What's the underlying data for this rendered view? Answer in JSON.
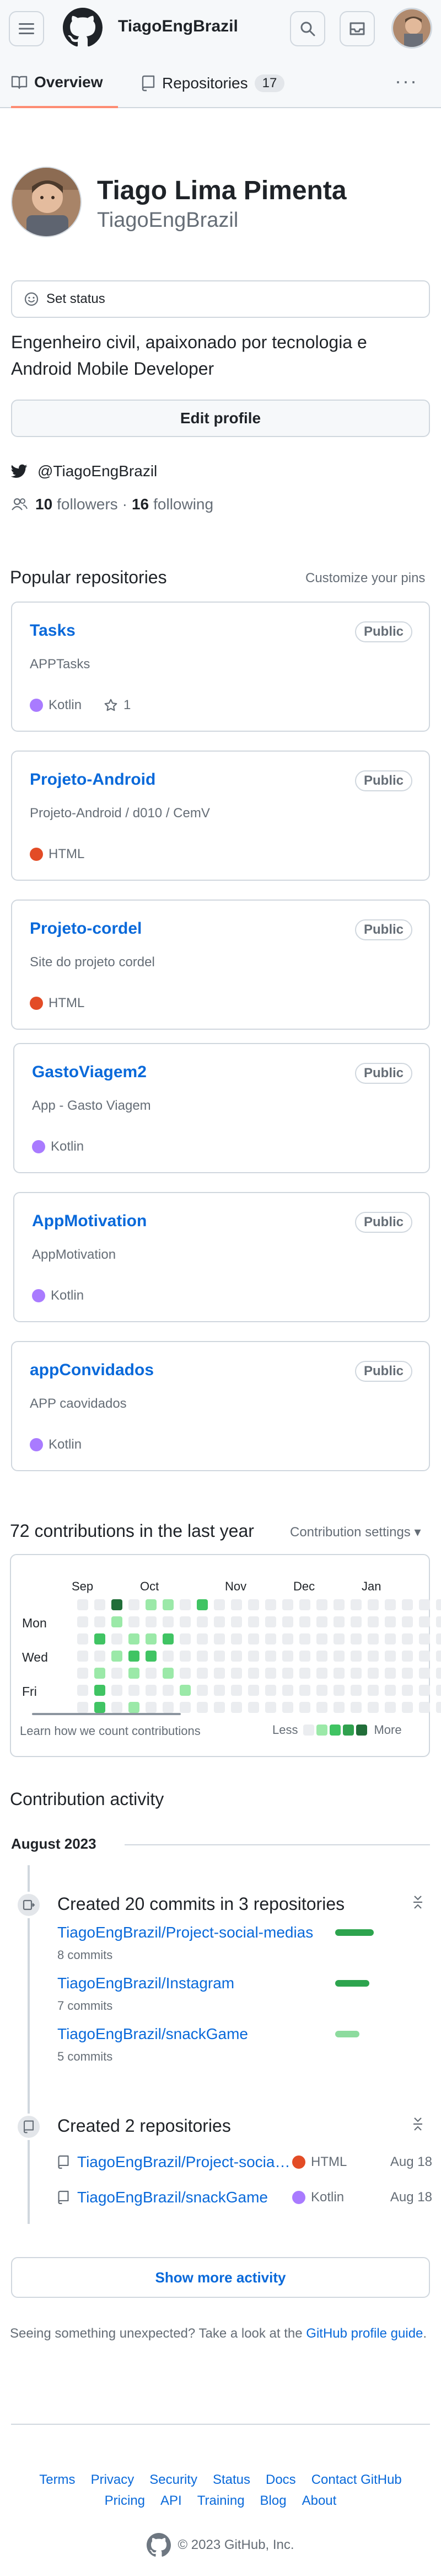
{
  "header": {
    "username": "TiagoEngBrazil"
  },
  "tabs": [
    {
      "label": "Overview"
    },
    {
      "label": "Repositories",
      "count": "17"
    }
  ],
  "profile": {
    "full_name": "Tiago Lima Pimenta",
    "login": "TiagoEngBrazil",
    "set_status": "Set status",
    "bio": "Engenheiro civil, apaixonado por tecnologia e Android Mobile Developer",
    "edit_profile": "Edit profile",
    "twitter": "@TiagoEngBrazil",
    "followers_count": "10",
    "followers_label": "followers",
    "separator": "·",
    "following_count": "16",
    "following_label": "following"
  },
  "popular": {
    "title": "Popular repositories",
    "customize": "Customize your pins",
    "repos": [
      {
        "name": "Tasks",
        "badge": "Public",
        "desc": "APPTasks",
        "lang": "Kotlin",
        "lang_color": "#a97bff",
        "stars": "1"
      },
      {
        "name": "Projeto-Android",
        "badge": "Public",
        "desc": "Projeto-Android / d010 / CemV",
        "lang": "HTML",
        "lang_color": "#e34c26"
      },
      {
        "name": "Projeto-cordel",
        "badge": "Public",
        "desc": "Site do projeto cordel",
        "lang": "HTML",
        "lang_color": "#e34c26"
      },
      {
        "name": "GastoViagem2",
        "badge": "Public",
        "desc": "App - Gasto Viagem",
        "lang": "Kotlin",
        "lang_color": "#a97bff"
      },
      {
        "name": "AppMotivation",
        "badge": "Public",
        "desc": "AppMotivation",
        "lang": "Kotlin",
        "lang_color": "#a97bff"
      },
      {
        "name": "appConvidados",
        "badge": "Public",
        "desc": "APP caovidados",
        "lang": "Kotlin",
        "lang_color": "#a97bff"
      }
    ]
  },
  "contributions": {
    "title": "72 contributions in the last year",
    "settings": "Contribution settings ▾",
    "months": [
      "Sep",
      "Oct",
      "Nov",
      "Dec",
      "Jan"
    ],
    "days": [
      "Mon",
      "Wed",
      "Fri"
    ],
    "learn": "Learn how we count contributions",
    "less": "Less",
    "more": "More",
    "level_colors": [
      "#ebedf0",
      "#9be9a8",
      "#40c463",
      "#30a14e",
      "#216e39"
    ]
  },
  "activity": {
    "title": "Contribution activity",
    "month": "August 2023",
    "commits_heading": "Created 20 commits in 3 repositories",
    "commit_repos": [
      {
        "name": "TiagoEngBrazil/Project-social-medias",
        "count": "8 commits",
        "share": 0.4,
        "color": "#2da44e"
      },
      {
        "name": "TiagoEngBrazil/Instagram",
        "count": "7 commits",
        "share": 0.35,
        "color": "#2da44e"
      },
      {
        "name": "TiagoEngBrazil/snackGame",
        "count": "5 commits",
        "share": 0.25,
        "color": "#8ddb9e"
      }
    ],
    "repos_heading": "Created 2 repositories",
    "new_repos": [
      {
        "name": "TiagoEngBrazil/Project-social-medias",
        "lang": "HTML",
        "lang_color": "#e34c26",
        "date": "Aug 18"
      },
      {
        "name": "TiagoEngBrazil/snackGame",
        "lang": "Kotlin",
        "lang_color": "#a97bff",
        "date": "Aug 18"
      }
    ],
    "show_more": "Show more activity",
    "unexpected_text": "Seeing something unexpected? Take a look at the ",
    "unexpected_link": "GitHub profile guide",
    "unexpected_end": "."
  },
  "footer": {
    "row1": [
      "Terms",
      "Privacy",
      "Security",
      "Status",
      "Docs",
      "Contact GitHub"
    ],
    "row2": [
      "Pricing",
      "API",
      "Training",
      "Blog",
      "About"
    ],
    "copyright": "© 2023 GitHub, Inc."
  }
}
